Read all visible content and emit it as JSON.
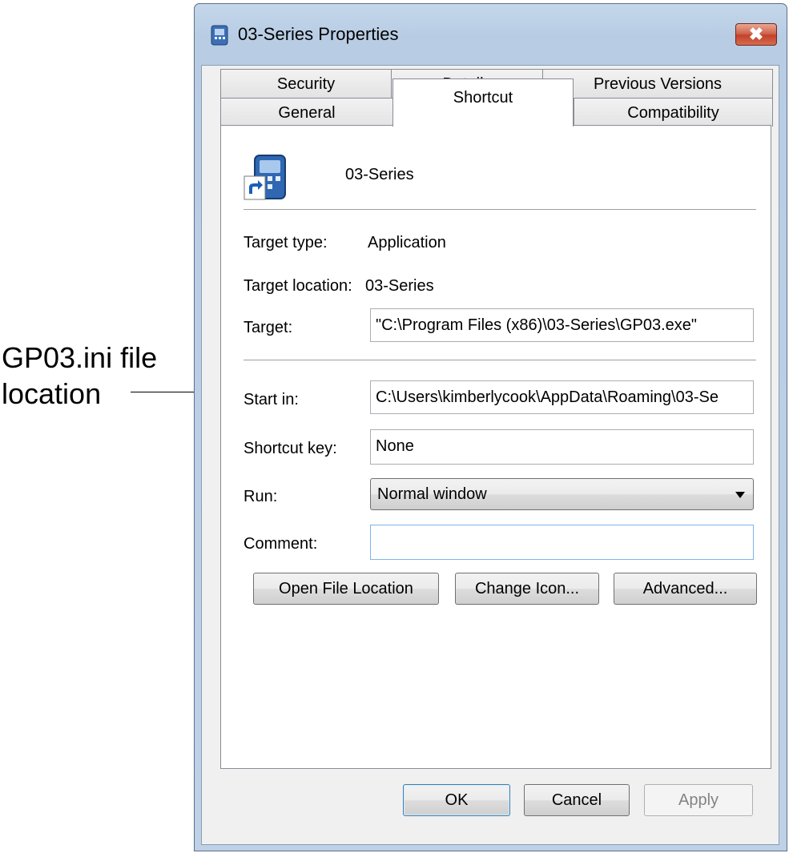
{
  "callout": {
    "line1": "GP03.ini file",
    "line2": "location"
  },
  "window": {
    "title": "03-Series Properties",
    "close_label": "✖"
  },
  "tabs": {
    "row1": [
      "Security",
      "Details",
      "Previous Versions"
    ],
    "row2": [
      "General",
      "Shortcut",
      "Compatibility"
    ],
    "active": "Shortcut"
  },
  "shortcut": {
    "name": "03-Series",
    "target_type_label": "Target type:",
    "target_type_value": "Application",
    "target_location_label": "Target location:",
    "target_location_value": "03-Series",
    "target_label": "Target:",
    "target_value": "\"C:\\Program Files (x86)\\03-Series\\GP03.exe\"",
    "start_in_label": "Start in:",
    "start_in_value": "C:\\Users\\kimberlycook\\AppData\\Roaming\\03-Se",
    "shortcut_key_label": "Shortcut key:",
    "shortcut_key_value": "None",
    "run_label": "Run:",
    "run_value": "Normal window",
    "comment_label": "Comment:",
    "comment_value": ""
  },
  "buttons": {
    "open_file_location": "Open File Location",
    "change_icon": "Change Icon...",
    "advanced": "Advanced...",
    "ok": "OK",
    "cancel": "Cancel",
    "apply": "Apply"
  }
}
